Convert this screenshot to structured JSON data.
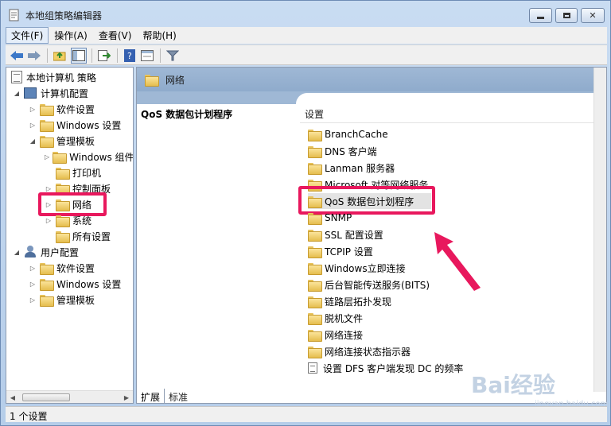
{
  "window": {
    "title": "本地组策略编辑器"
  },
  "menu": {
    "items": [
      "文件(F)",
      "操作(A)",
      "查看(V)",
      "帮助(H)"
    ]
  },
  "tree": {
    "root": "本地计算机 策略",
    "computer_config": "计算机配置",
    "cc_software": "软件设置",
    "cc_windows": "Windows 设置",
    "cc_admin": "管理模板",
    "cc_admin_windows": "Windows 组件",
    "cc_admin_printers": "打印机",
    "cc_admin_control_panel": "控制面板",
    "cc_admin_network": "网络",
    "cc_admin_system": "系统",
    "cc_admin_all": "所有设置",
    "user_config": "用户配置",
    "uc_software": "软件设置",
    "uc_windows": "Windows 设置",
    "uc_admin": "管理模板"
  },
  "right_pane": {
    "header": "网络",
    "selected_title": "QoS 数据包计划程序",
    "column_header": "设置",
    "items": [
      "BranchCache",
      "DNS 客户端",
      "Lanman 服务器",
      "Microsoft 对等网络服务",
      "QoS 数据包计划程序",
      "SNMP",
      "SSL 配置设置",
      "TCPIP 设置",
      "Windows立即连接",
      "后台智能传送服务(BITS)",
      "链路层拓扑发现",
      "脱机文件",
      "网络连接",
      "网络连接状态指示器",
      "设置 DFS 客户端发现 DC 的频率"
    ]
  },
  "tabs": {
    "extended": "扩展",
    "standard": "标准"
  },
  "status": {
    "text": "1 个设置"
  },
  "watermark": {
    "brand": "Bai经验",
    "url": "jingyan.baidu.com"
  },
  "colors": {
    "highlight": "#e8185d",
    "header_blue": "#9fb8d5"
  }
}
